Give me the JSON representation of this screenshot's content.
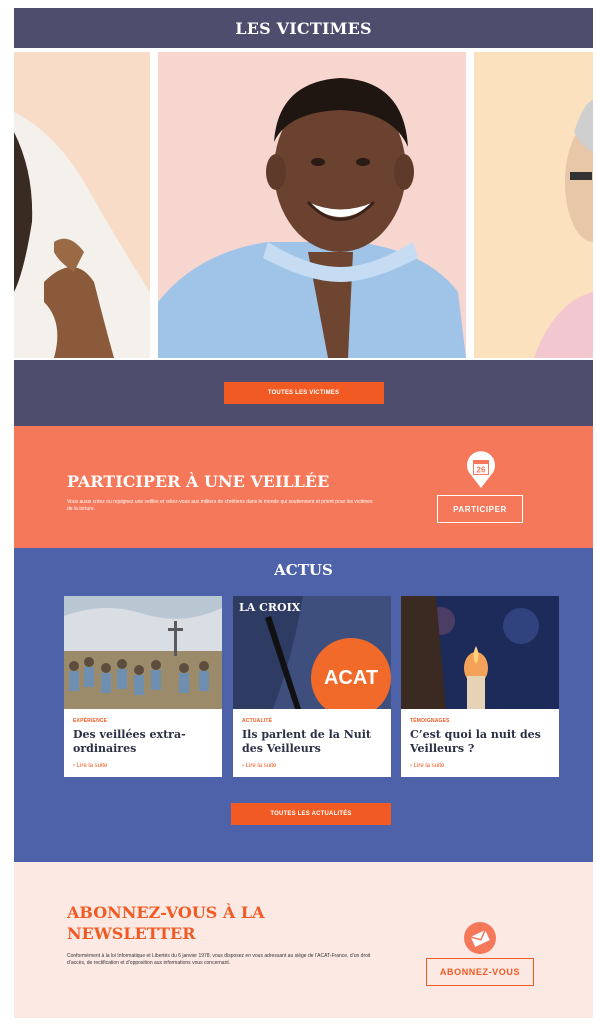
{
  "victims": {
    "title": "LES VICTIMES",
    "button_label": "TOUTES LES VICTIMES",
    "panel_colors": [
      "#f9dcc7",
      "#f7d6d0",
      "#fbe1bd"
    ]
  },
  "veillee": {
    "title": "PARTICIPER À UNE VEILLÉE",
    "text": "Vous aussi créez ou rejoignez une veillée et reliez-vous aux milliers de chrétiens dans le monde qui soutiennent et prient pour les victimes de la torture.",
    "calendar_day": "26",
    "icon": "calendar-pin-icon",
    "button_label": "PARTICIPER"
  },
  "actus": {
    "title": "ACTUS",
    "cards": [
      {
        "category": "EXPÉRIENCE",
        "title": "Des veillées extra-ordinaires",
        "more": "› Lire la suite"
      },
      {
        "category": "ACTUALITÉ",
        "title": "Ils parlent de la Nuit des Veilleurs",
        "more": "› Lire la suite",
        "image_text": {
          "brand": "LA CROIX",
          "badge": "ACAT"
        }
      },
      {
        "category": "TÉMOIGNAGES",
        "title": "C’est quoi la nuit des Veilleurs ?",
        "more": "› Lire la suite"
      }
    ],
    "button_label": "TOUTES LES ACTUALITÉS"
  },
  "newsletter": {
    "title": "ABONNEZ-VOUS À LA NEWSLETTER",
    "text": "Conformément à la loi Informatique et Libertés du 6 janvier 1978, vous disposez en vous adressant au siège de l’ACAT-France, d’un droit d’accès, de rectification et d’opposition aux informations vous concernant.",
    "icon": "envelope-icon",
    "button_label": "ABONNEZ-VOUS"
  },
  "colors": {
    "dark_band": "#4f4d6e",
    "orange": "#f15a22",
    "salmon": "#f6785a",
    "blue": "#4d62a8",
    "newsletter_bg": "#fce9e4"
  }
}
